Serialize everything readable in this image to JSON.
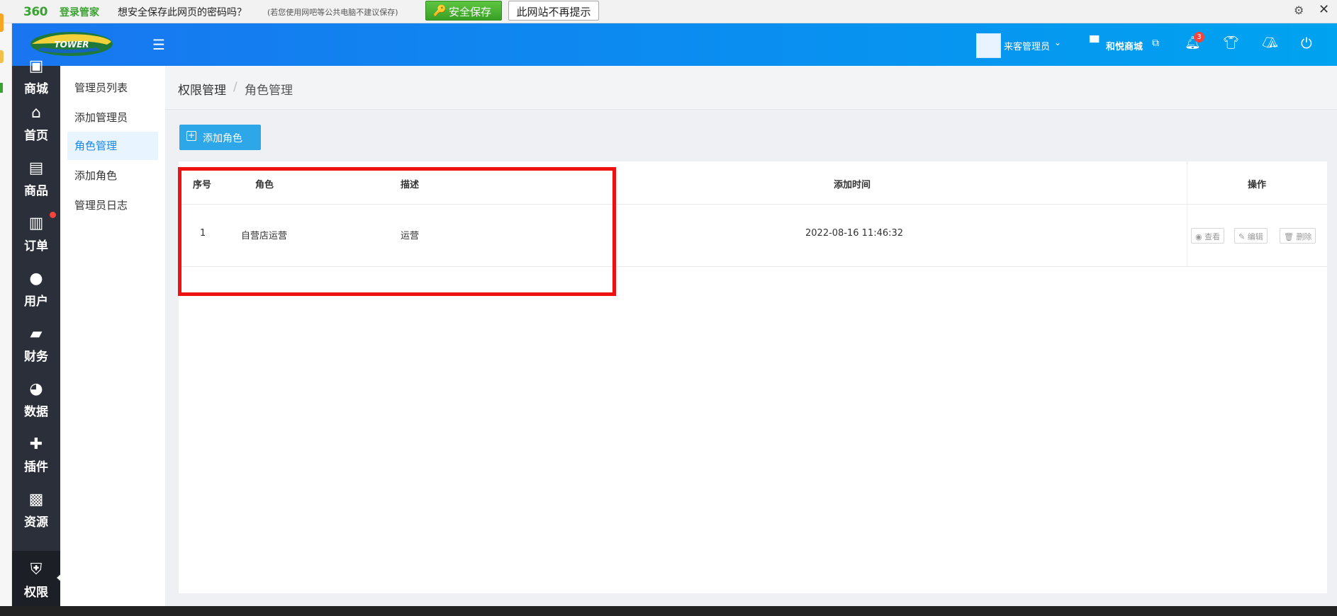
{
  "password_bar": {
    "logo_number": "360",
    "logo_text": "登录管家",
    "question": "想安全保存此网页的密码吗？",
    "hint": "(若您使用网吧等公共电脑不建议保存)",
    "save_button": "安全保存",
    "never_button": "此网站不再提示"
  },
  "header": {
    "brand_text": "TOWER",
    "admin_name": "来客管理员",
    "store_name": "和悦商城",
    "notification_count": "3"
  },
  "sidebar": {
    "items": [
      {
        "label": "商城",
        "icon": "store-icon"
      },
      {
        "label": "首页",
        "icon": "home-icon"
      },
      {
        "label": "商品",
        "icon": "bag-icon"
      },
      {
        "label": "订单",
        "icon": "clipboard-icon"
      },
      {
        "label": "用户",
        "icon": "user-icon"
      },
      {
        "label": "财务",
        "icon": "wallet-icon"
      },
      {
        "label": "数据",
        "icon": "pie-chart-icon"
      },
      {
        "label": "插件",
        "icon": "puzzle-icon"
      },
      {
        "label": "资源",
        "icon": "image-icon"
      },
      {
        "label": "权限",
        "icon": "shield-lock-icon"
      }
    ]
  },
  "submenu": {
    "items": [
      "管理员列表",
      "添加管理员",
      "角色管理",
      "添加角色",
      "管理员日志"
    ],
    "active_index": 2
  },
  "breadcrumb": {
    "parent": "权限管理",
    "separator": "/",
    "current": "角色管理"
  },
  "toolbar": {
    "add_role_label": "添加角色"
  },
  "table": {
    "headers": {
      "index": "序号",
      "role": "角色",
      "desc": "描述",
      "time": "添加时间",
      "ops": "操作"
    },
    "rows": [
      {
        "index": "1",
        "role": "自营店运营",
        "desc": "运营",
        "time": "2022-08-16 11:46:32",
        "view": "查看",
        "edit": "编辑",
        "delete": "删除"
      }
    ]
  },
  "colors": {
    "header_start": "#1976f0",
    "header_end": "#00a3f0",
    "sidenav": "#2b2f3a",
    "accent": "#2ea7e8",
    "highlight": "#ee1111"
  }
}
